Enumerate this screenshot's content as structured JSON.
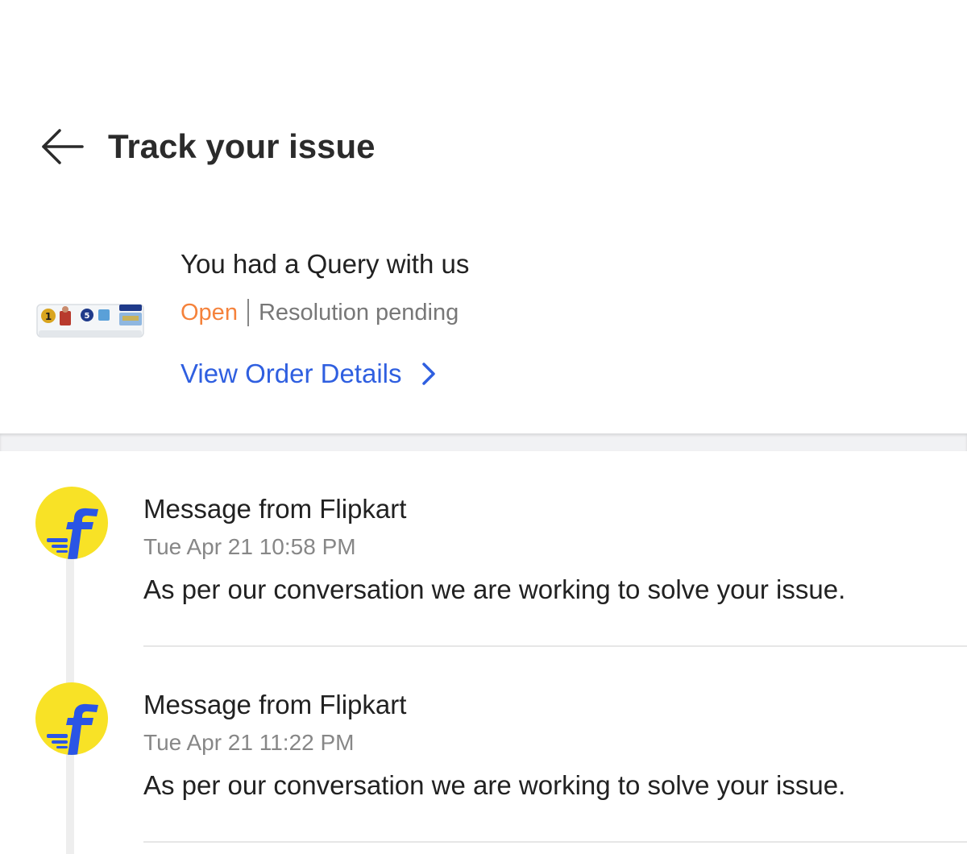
{
  "header": {
    "title": "Track your issue",
    "back_icon": "arrow-left-icon"
  },
  "issue": {
    "title": "You had a Query with us",
    "status": "Open",
    "status_detail": "Resolution pending",
    "order_link_label": "View Order Details",
    "link_icon": "chevron-right-icon",
    "product_image": "air-conditioner-thumbnail"
  },
  "colors": {
    "status_open": "#f5823b",
    "link": "#2f5fe0",
    "avatar_bg": "#f8e226",
    "avatar_logo": "#2a55e5"
  },
  "messages": [
    {
      "sender": "Message from Flipkart",
      "time": "Tue Apr 21 10:58 PM",
      "body": "As per our conversation we are working to solve your issue.",
      "avatar_icon": "flipkart-logo-icon"
    },
    {
      "sender": "Message from Flipkart",
      "time": "Tue Apr 21 11:22 PM",
      "body": "As per our conversation we are working to solve your issue.",
      "avatar_icon": "flipkart-logo-icon"
    }
  ]
}
